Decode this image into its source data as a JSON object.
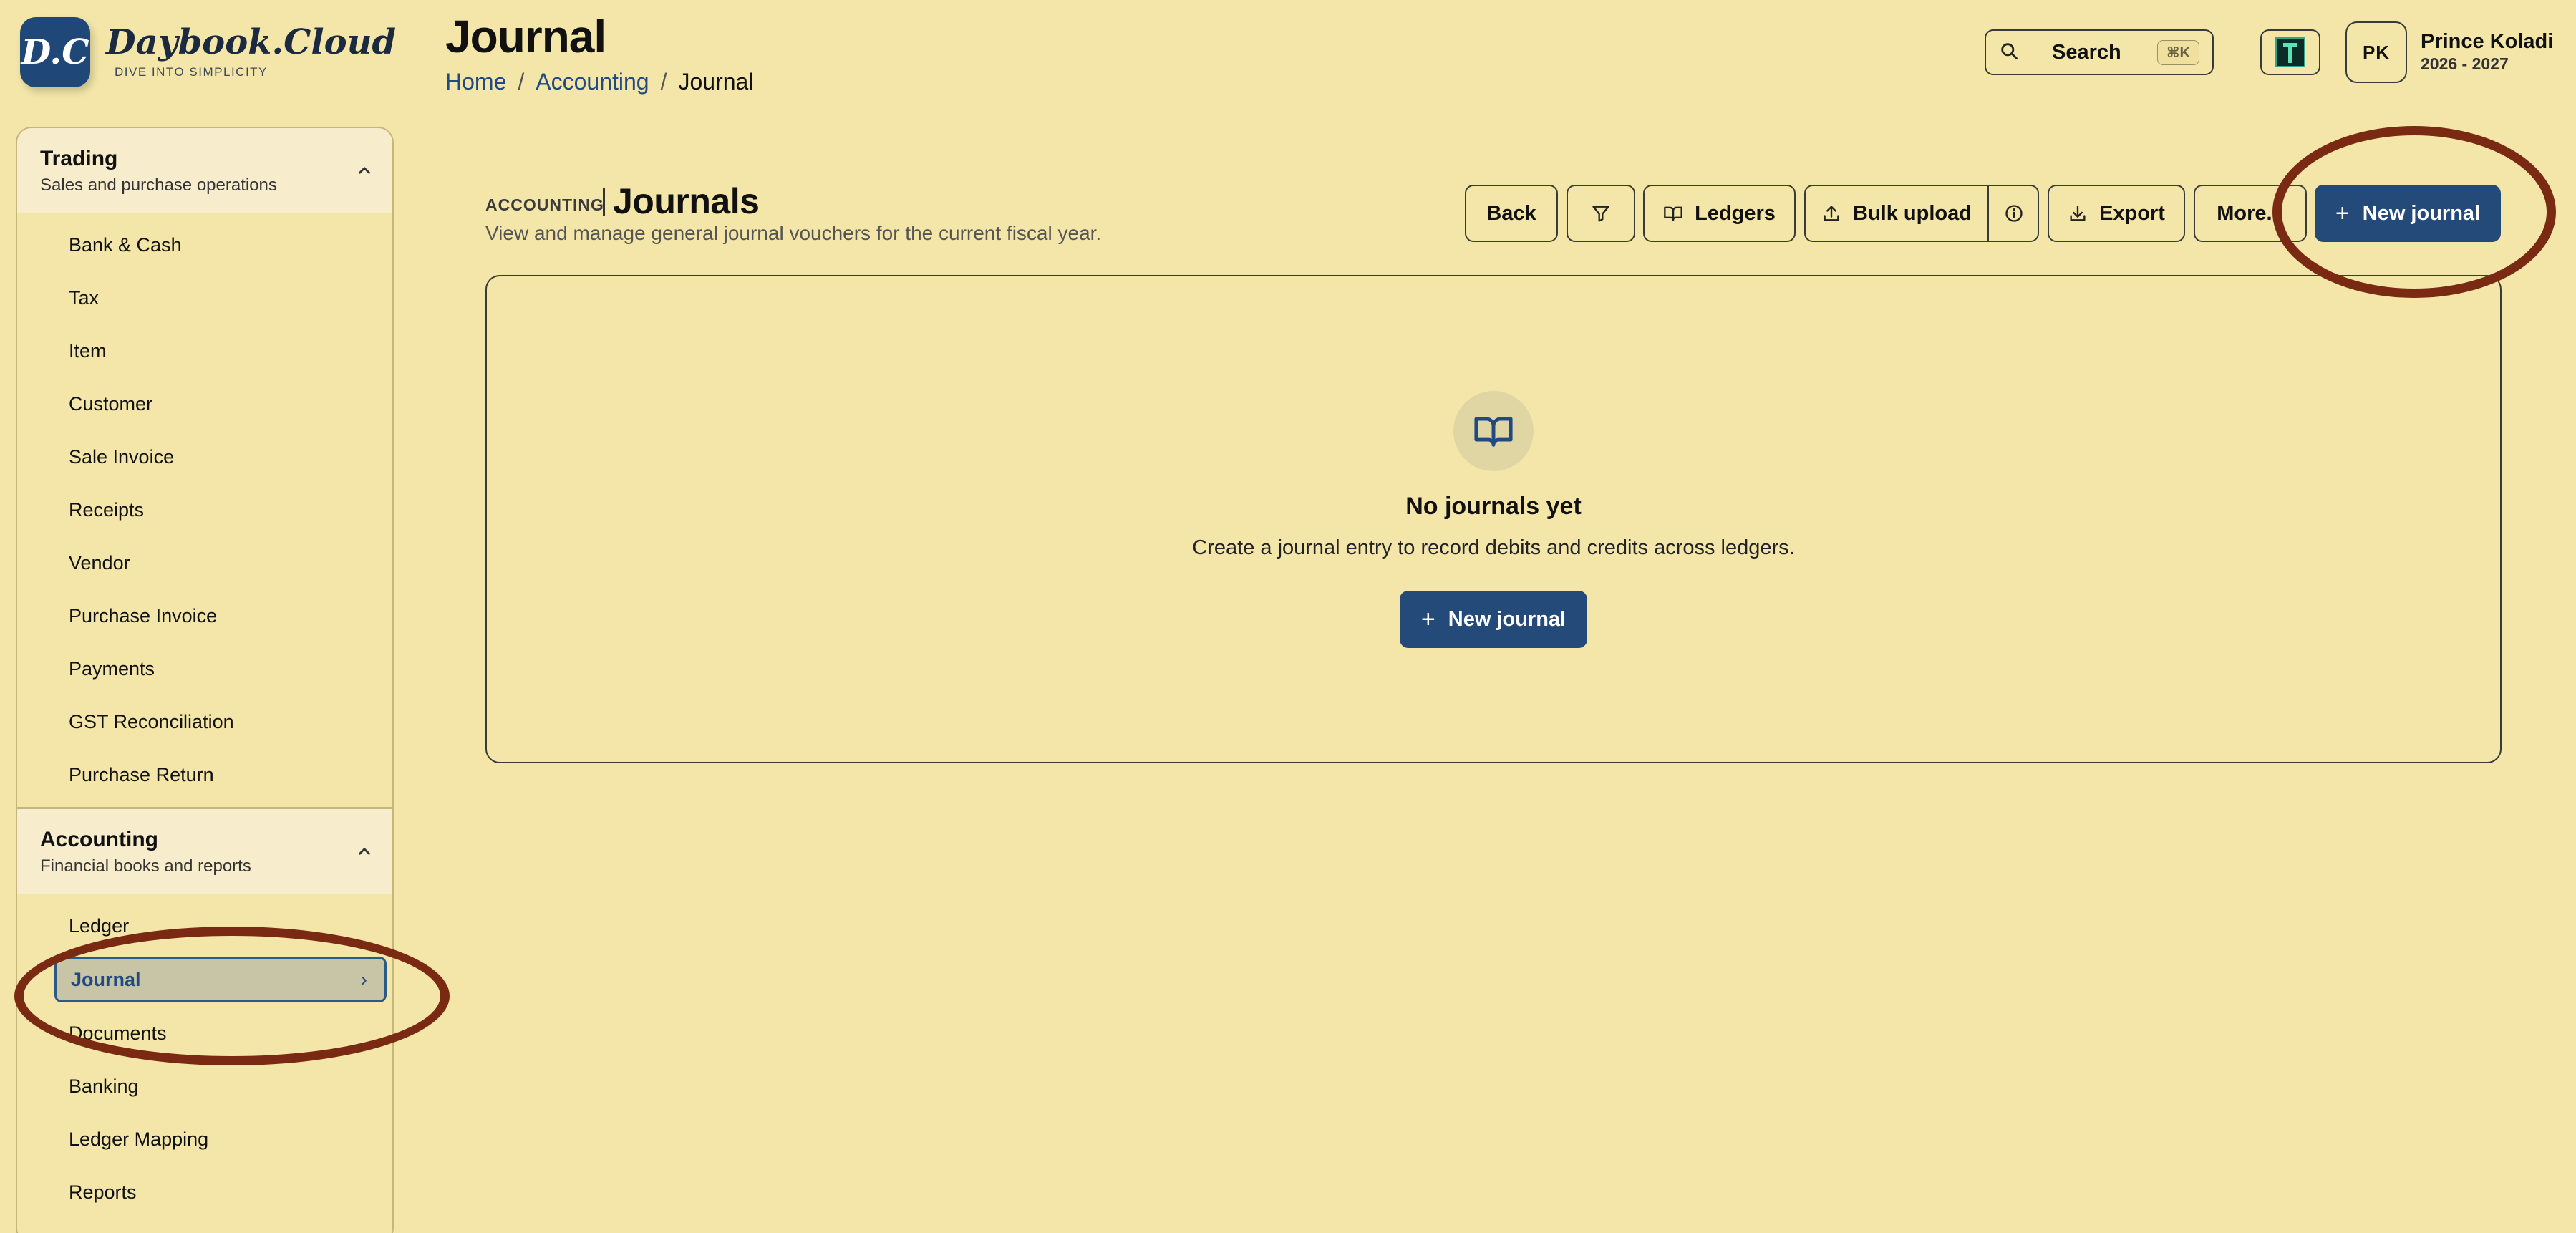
{
  "brand": {
    "logo_text": "D.C",
    "name": "Daybook.Cloud",
    "tagline": "DIVE INTO SIMPLICITY"
  },
  "header": {
    "title": "Journal",
    "breadcrumb": [
      "Home",
      "Accounting",
      "Journal"
    ],
    "breadcrumb_separator": "/",
    "search": {
      "label": "Search",
      "shortcut": "⌘K",
      "icon": "search-icon"
    },
    "theme_icon": "theme-icon",
    "user": {
      "initials": "PK",
      "name": "Prince Koladi",
      "fiscal_year": "2026 - 2027"
    }
  },
  "sidebar": {
    "groups": [
      {
        "title": "Trading",
        "subtitle": "Sales and purchase operations",
        "expanded": true,
        "items": [
          "Bank & Cash",
          "Tax",
          "Item",
          "Customer",
          "Sale Invoice",
          "Receipts",
          "Vendor",
          "Purchase Invoice",
          "Payments",
          "GST Reconciliation",
          "Purchase Return"
        ]
      },
      {
        "title": "Accounting",
        "subtitle": "Financial books and reports",
        "expanded": true,
        "items": [
          "Ledger",
          "Journal",
          "Documents",
          "Banking",
          "Ledger Mapping",
          "Reports"
        ],
        "active_item": "Journal"
      }
    ]
  },
  "main": {
    "kicker": "ACCOUNTING",
    "title": "Journals",
    "description": "View and manage general journal vouchers for the current fiscal year.",
    "toolbar": {
      "back": "Back",
      "filter_icon": "filter-icon",
      "ledgers": "Ledgers",
      "bulk_upload": "Bulk upload",
      "info_icon": "info-icon",
      "export": "Export",
      "more": "More...",
      "new_journal": "New journal"
    },
    "empty_state": {
      "icon": "book-open-icon",
      "title": "No journals yet",
      "description": "Create a journal entry to record debits and credits across ledgers.",
      "cta": "New journal"
    }
  },
  "colors": {
    "background": "#f3e6a8",
    "primary": "#244a7a",
    "annotation": "#7a2a12"
  }
}
